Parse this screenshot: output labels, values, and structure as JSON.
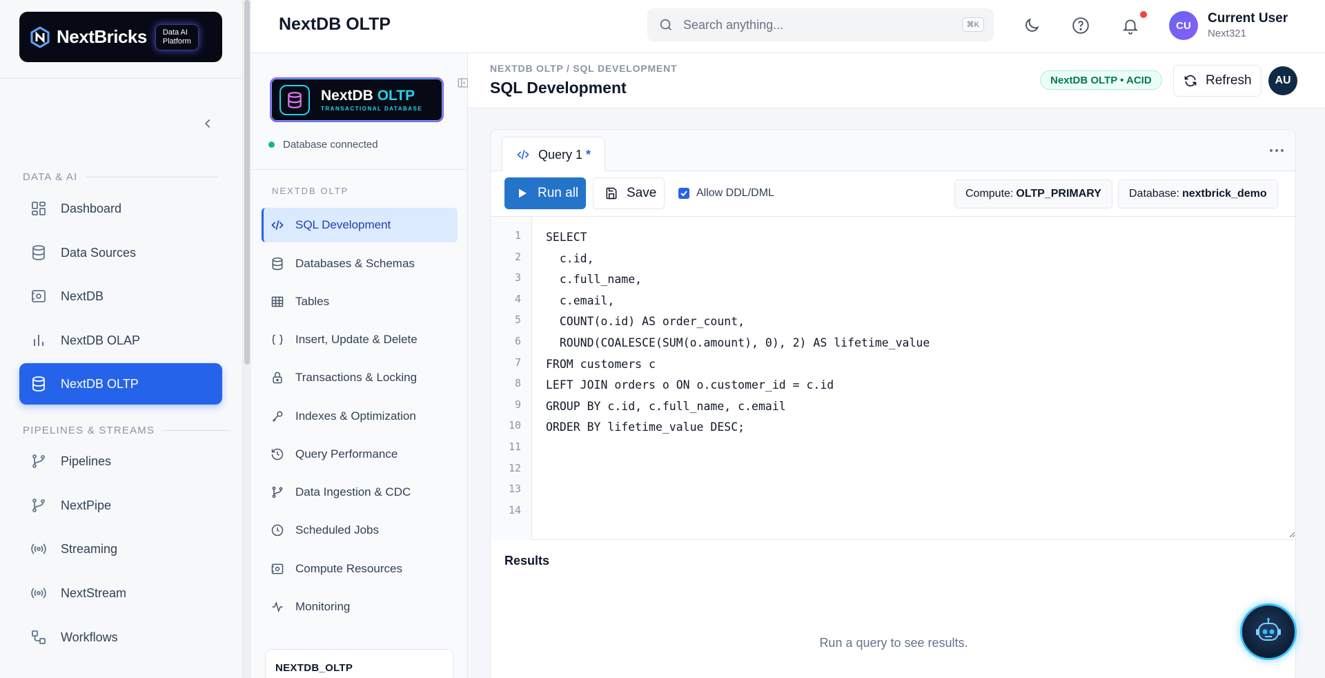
{
  "sidebar": {
    "brand": "NextBricks",
    "brand_tag_line1": "Data AI",
    "brand_tag_line2": "Platform",
    "sections": [
      {
        "label": "DATA & AI"
      },
      {
        "label": "PIPELINES & STREAMS"
      }
    ],
    "items": [
      {
        "label": "Dashboard",
        "icon": "dashboard-icon"
      },
      {
        "label": "Data Sources",
        "icon": "database-icon"
      },
      {
        "label": "NextDB",
        "icon": "nextdb-icon"
      },
      {
        "label": "NextDB OLAP",
        "icon": "bar-chart-icon"
      },
      {
        "label": "NextDB OLTP",
        "icon": "database-icon",
        "active": true
      },
      {
        "label": "Pipelines",
        "icon": "branch-icon"
      },
      {
        "label": "NextPipe",
        "icon": "branch-icon"
      },
      {
        "label": "Streaming",
        "icon": "broadcast-icon"
      },
      {
        "label": "NextStream",
        "icon": "broadcast-icon"
      },
      {
        "label": "Workflows",
        "icon": "workflow-icon"
      }
    ]
  },
  "header": {
    "title": "NextDB OLTP",
    "search_placeholder": "Search anything...",
    "search_shortcut": "⌘K",
    "user_initials": "CU",
    "user_name": "Current User",
    "user_sub": "Next321"
  },
  "subnav": {
    "logo_title_a": "NextDB ",
    "logo_title_b": "OLTP",
    "logo_subtitle": "TRANSACTIONAL DATABASE",
    "status": "Database connected",
    "section_label": "NEXTDB OLTP",
    "items": [
      {
        "label": "SQL Development",
        "icon": "code-icon",
        "active": true
      },
      {
        "label": "Databases & Schemas",
        "icon": "database-icon"
      },
      {
        "label": "Tables",
        "icon": "table-icon"
      },
      {
        "label": "Insert, Update & Delete",
        "icon": "braces-icon"
      },
      {
        "label": "Transactions & Locking",
        "icon": "lock-icon"
      },
      {
        "label": "Indexes & Optimization",
        "icon": "key-icon"
      },
      {
        "label": "Query Performance",
        "icon": "history-icon"
      },
      {
        "label": "Data Ingestion & CDC",
        "icon": "branch-icon"
      },
      {
        "label": "Scheduled Jobs",
        "icon": "clock-icon"
      },
      {
        "label": "Compute Resources",
        "icon": "compute-icon"
      },
      {
        "label": "Monitoring",
        "icon": "activity-icon"
      }
    ],
    "footer_label": "NEXTDB_OLTP"
  },
  "page": {
    "breadcrumb": "NEXTDB OLTP / SQL DEVELOPMENT",
    "title": "SQL Development",
    "badge": "NextDB OLTP • ACID",
    "refresh_label": "Refresh",
    "avatar_initials": "AU"
  },
  "editor": {
    "tab_label": "Query 1",
    "tab_dirty": "*",
    "run_label": "Run all",
    "save_label": "Save",
    "allow_ddl_label": "Allow DDL/DML",
    "allow_ddl_checked": true,
    "compute_label": "Compute:",
    "compute_value": "OLTP_PRIMARY",
    "database_label": "Database:",
    "database_value": "nextbrick_demo",
    "line_numbers": [
      "1",
      "2",
      "3",
      "4",
      "5",
      "6",
      "7",
      "8",
      "9",
      "10",
      "11",
      "12",
      "13",
      "14"
    ],
    "code_lines": [
      "SELECT",
      "  c.id,",
      "  c.full_name,",
      "  c.email,",
      "  COUNT(o.id) AS order_count,",
      "  ROUND(COALESCE(SUM(o.amount), 0), 2) AS lifetime_value",
      "FROM customers c",
      "LEFT JOIN orders o ON o.customer_id = c.id",
      "GROUP BY c.id, c.full_name, c.email",
      "ORDER BY lifetime_value DESC;",
      "",
      "",
      "",
      ""
    ]
  },
  "results": {
    "title": "Results",
    "empty_message": "Run a query to see results."
  },
  "colors": {
    "accent": "#2563eb",
    "run_button": "#2474c9",
    "success": "#10b981",
    "notification": "#ef4444"
  }
}
